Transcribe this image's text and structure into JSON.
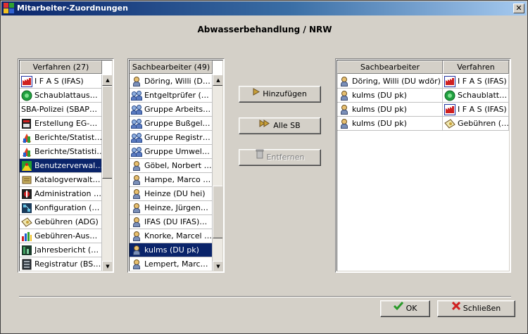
{
  "window": {
    "title": "Mitarbeiter-Zuordnungen",
    "close_glyph": "✕"
  },
  "heading": "Abwasserbehandlung / NRW",
  "left_list": {
    "header": "Verfahren (27)",
    "items": [
      {
        "label": "I F A S (IFAS)",
        "icon": "ifas-factory-icon",
        "selected": false
      },
      {
        "label": "Schaublattaus…",
        "icon": "green-disc-icon",
        "selected": false
      },
      {
        "label": "SBA-Polizei (SBAP…",
        "icon": "",
        "selected": false
      },
      {
        "label": "Erstellung EG-…",
        "icon": "register-icon",
        "selected": false
      },
      {
        "label": "Berichte/Statist…",
        "icon": "report-icon",
        "selected": false
      },
      {
        "label": "Berichte/Statisti…",
        "icon": "report-icon",
        "selected": false
      },
      {
        "label": "Benutzerverwal…",
        "icon": "users-admin-icon",
        "selected": true
      },
      {
        "label": "Katalogverwalt…",
        "icon": "catalog-icon",
        "selected": false
      },
      {
        "label": "Administration …",
        "icon": "admin-icon",
        "selected": false
      },
      {
        "label": "Konfiguration (…",
        "icon": "config-icon",
        "selected": false
      },
      {
        "label": "Gebühren (ADG)",
        "icon": "fees-icon",
        "selected": false
      },
      {
        "label": "Gebühren-Aus…",
        "icon": "bar-chart-icon",
        "selected": false
      },
      {
        "label": "Jahresbericht (…",
        "icon": "yearly-report-icon",
        "selected": false
      },
      {
        "label": "Registratur (BS…",
        "icon": "registry-icon",
        "selected": false
      }
    ]
  },
  "mid_list": {
    "header": "Sachbearbeiter (49)",
    "items": [
      {
        "label": "Döring, Willi (D…",
        "icon": "person-icon",
        "selected": false
      },
      {
        "label": "Entgeltprüfer (…",
        "icon": "group-icon",
        "selected": false
      },
      {
        "label": "Gruppe Arbeits…",
        "icon": "group-icon",
        "selected": false
      },
      {
        "label": "Gruppe Bußgel…",
        "icon": "group-icon",
        "selected": false
      },
      {
        "label": "Gruppe Registr…",
        "icon": "group-icon",
        "selected": false
      },
      {
        "label": "Gruppe Umwel…",
        "icon": "group-icon",
        "selected": false
      },
      {
        "label": "Göbel, Norbert …",
        "icon": "person-icon",
        "selected": false
      },
      {
        "label": "Hampe, Marco …",
        "icon": "person-icon",
        "selected": false
      },
      {
        "label": "Heinze (DU hei)",
        "icon": "person-icon",
        "selected": false
      },
      {
        "label": "Heinze, Jürgen…",
        "icon": "person-icon",
        "selected": false
      },
      {
        "label": "IFAS (DU IFAS)…",
        "icon": "person-icon",
        "selected": false
      },
      {
        "label": "Knorke, Marcel …",
        "icon": "person-icon",
        "selected": false
      },
      {
        "label": "kulms (DU pk)",
        "icon": "person-icon",
        "selected": true
      },
      {
        "label": "Lempert, Marc…",
        "icon": "person-icon",
        "selected": false
      }
    ]
  },
  "buttons": {
    "add": "Hinzufügen",
    "all": "Alle SB",
    "remove": "Entfernen",
    "ok": "OK",
    "close": "Schließen"
  },
  "right_table": {
    "headers": [
      "Sachbearbeiter",
      "Verfahren"
    ],
    "rows": [
      {
        "sb": "Döring, Willi (DU wdör)",
        "verfahren": "I F A S (IFAS)",
        "v_icon": "ifas-factory-icon"
      },
      {
        "sb": "kulms (DU pk)",
        "verfahren": "Schaublatt…",
        "v_icon": "green-disc-icon"
      },
      {
        "sb": "kulms (DU pk)",
        "verfahren": "I F A S (IFAS)",
        "v_icon": "ifas-factory-icon"
      },
      {
        "sb": "kulms (DU pk)",
        "verfahren": "Gebühren (…",
        "v_icon": "fees-icon"
      }
    ]
  }
}
